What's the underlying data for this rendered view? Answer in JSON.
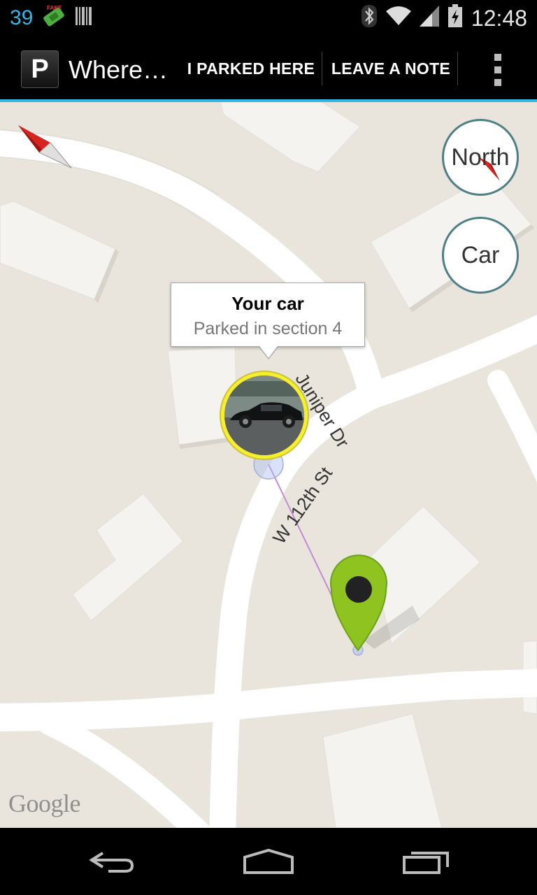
{
  "status_bar": {
    "notification_count": "39",
    "time": "12:48",
    "icons": [
      "fake-gps-icon",
      "barcode-icon",
      "bluetooth-icon",
      "wifi-icon",
      "signal-icon",
      "battery-icon"
    ]
  },
  "action_bar": {
    "app_icon_letter": "P",
    "title": "Where…",
    "buttons": [
      "I PARKED HERE",
      "LEAVE A NOTE"
    ],
    "overflow_icon": "overflow-menu-icon"
  },
  "map": {
    "streets": [
      "Juniper Dr",
      "W 112th St"
    ],
    "controls": {
      "north": "North",
      "car": "Car"
    },
    "info_window": {
      "title": "Your car",
      "subtitle": "Parked in section 4"
    },
    "attribution": "Google",
    "colors": {
      "road": "#ffffff",
      "land": "#e9e5dc",
      "building": "#f4f3f0",
      "marker_ring": "#f7ef2a",
      "pin": "#8fc31f",
      "accent": "#33b5e5"
    }
  },
  "nav_bar": {
    "icons": [
      "back-icon",
      "home-icon",
      "recent-apps-icon"
    ]
  }
}
